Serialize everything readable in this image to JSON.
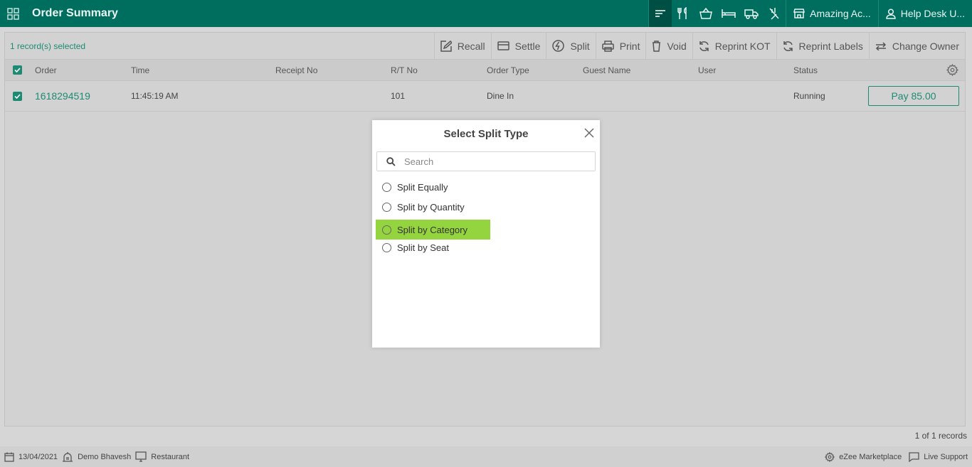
{
  "header": {
    "title": "Order Summary",
    "property_label": "Amazing Ac...",
    "user_label": "Help Desk U...",
    "icons": [
      "apps-grid-icon",
      "sort-lines-icon",
      "restaurant-icon",
      "basket-icon",
      "bed-icon",
      "truck-icon",
      "no-service-icon",
      "store-icon",
      "user-icon"
    ]
  },
  "toolbar": {
    "selected_text": "1 record(s) selected",
    "actions": {
      "recall": "Recall",
      "settle": "Settle",
      "split": "Split",
      "print": "Print",
      "void": "Void",
      "reprint_kot": "Reprint KOT",
      "reprint_labels": "Reprint Labels",
      "change_owner": "Change Owner"
    }
  },
  "table": {
    "columns": {
      "order": "Order",
      "time": "Time",
      "receipt_no": "Receipt No",
      "rt_no": "R/T No",
      "order_type": "Order Type",
      "guest_name": "Guest Name",
      "user": "User",
      "status": "Status"
    },
    "rows": [
      {
        "order": "1618294519",
        "time": "11:45:19 AM",
        "receipt_no": "",
        "rt_no": "101",
        "order_type": "Dine In",
        "guest_name": "",
        "user": "",
        "status": "Running",
        "pay_label": "Pay 85.00"
      }
    ],
    "records_text": "1 of 1 records"
  },
  "modal": {
    "title": "Select Split Type",
    "search_placeholder": "Search",
    "options": [
      "Split Equally",
      "Split by Quantity",
      "Split by Category",
      "Split by Seat"
    ],
    "highlighted_option": "Split by Category"
  },
  "footer": {
    "date": "13/04/2021",
    "user": "Demo Bhavesh",
    "outlet": "Restaurant",
    "marketplace": "eZee Marketplace",
    "support": "Live Support"
  },
  "colors": {
    "brand": "#006e5f",
    "accent": "#1d8b73",
    "highlight": "#94d53f"
  }
}
